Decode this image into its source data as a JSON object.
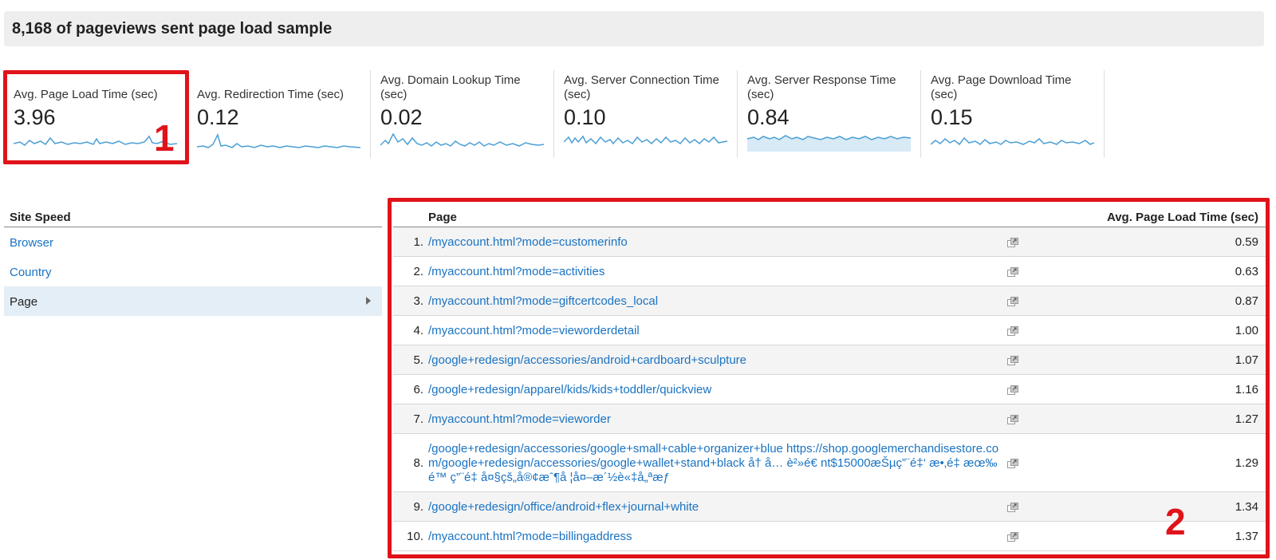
{
  "banner": {
    "text": "8,168 of pageviews sent page load sample"
  },
  "metrics": [
    {
      "label": "Avg. Page Load Time (sec)",
      "value": "3.96"
    },
    {
      "label": "Avg. Redirection Time (sec)",
      "value": "0.12"
    },
    {
      "label": "Avg. Domain Lookup Time (sec)",
      "value": "0.02"
    },
    {
      "label": "Avg. Server Connection Time (sec)",
      "value": "0.10"
    },
    {
      "label": "Avg. Server Response Time (sec)",
      "value": "0.84"
    },
    {
      "label": "Avg. Page Download Time (sec)",
      "value": "0.15"
    }
  ],
  "annotations": {
    "one": "1",
    "two": "2"
  },
  "dimensions": {
    "header": "Site Speed",
    "items": [
      "Browser",
      "Country",
      "Page"
    ]
  },
  "table": {
    "col_page": "Page",
    "col_time": "Avg. Page Load Time (sec)",
    "rows": [
      {
        "idx": "1.",
        "url": "/myaccount.html?mode=customerinfo",
        "val": "0.59"
      },
      {
        "idx": "2.",
        "url": "/myaccount.html?mode=activities",
        "val": "0.63"
      },
      {
        "idx": "3.",
        "url": "/myaccount.html?mode=giftcertcodes_local",
        "val": "0.87"
      },
      {
        "idx": "4.",
        "url": "/myaccount.html?mode=vieworderdetail",
        "val": "1.00"
      },
      {
        "idx": "5.",
        "url": "/google+redesign/accessories/android+cardboard+sculpture",
        "val": "1.07"
      },
      {
        "idx": "6.",
        "url": "/google+redesign/apparel/kids/kids+toddler/quickview",
        "val": "1.16"
      },
      {
        "idx": "7.",
        "url": "/myaccount.html?mode=vieworder",
        "val": "1.27"
      },
      {
        "idx": "8.",
        "url": "/google+redesign/accessories/google+small+cable+organizer+blue https://shop.googlemerchandisestore.com/google+redesign/accessories/google+wallet+stand+black å† å… è²»é€ nt$15000æŠµç”¨é‡‘ æ•‚é‡ æœ‰é™ ç”¨é‡ å¤§çš„å®¢æˆ¶å ¦å¤–æ´½è«‡å„ªæƒ",
        "val": "1.29"
      },
      {
        "idx": "9.",
        "url": "/google+redesign/office/android+flex+journal+white",
        "val": "1.34"
      },
      {
        "idx": "10.",
        "url": "/myaccount.html?mode=billingaddress",
        "val": "1.37"
      }
    ]
  },
  "colors": {
    "link": "#1a73c2",
    "highlight": "#e0131a",
    "spark": "#4a9fd5"
  }
}
